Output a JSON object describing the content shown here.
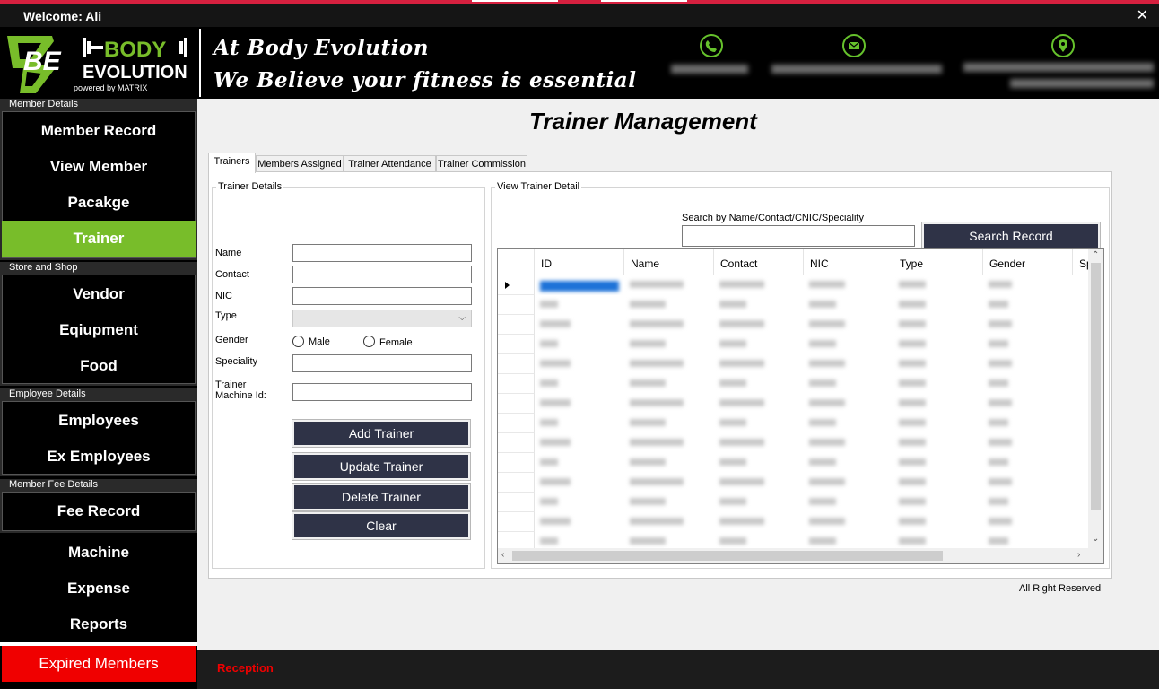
{
  "window": {
    "welcome": "Welcome: Ali",
    "close_glyph": "✕"
  },
  "brand": {
    "logo_letters": "BE",
    "name_line1": "BODY",
    "name_line2": "EVOLUTION",
    "powered": "powered by MATRIX",
    "slogan_line1": "At Body Evolution",
    "slogan_line2": "We Believe your fitness is essential",
    "accent": "#78bd2a",
    "icons": [
      "phone-icon",
      "mail-icon",
      "location-pin-icon"
    ]
  },
  "sidebar": {
    "groups": [
      {
        "label": "Member Details",
        "items": [
          "Member Record",
          "View Member",
          "Pacakge",
          "Trainer"
        ]
      },
      {
        "label": "Store and Shop",
        "items": [
          "Vendor",
          "Eqiupment",
          "Food"
        ]
      },
      {
        "label": "Employee Details",
        "items": [
          "Employees",
          "Ex Employees"
        ]
      },
      {
        "label": "Member Fee Details",
        "items": [
          "Fee Record"
        ]
      }
    ],
    "items": [
      "Machine",
      "Expense",
      "Reports"
    ],
    "expired": "Expired Members",
    "active_item": "Trainer"
  },
  "page": {
    "title": "Trainer Management"
  },
  "tabs": [
    "Trainers",
    "Members Assigned",
    "Trainer Attendance",
    "Trainer Commission"
  ],
  "form": {
    "legend": "Trainer Details",
    "name_label": "Name",
    "name_value": "",
    "contact_label": "Contact",
    "contact_value": "",
    "nic_label": "NIC",
    "nic_value": "",
    "type_label": "Type",
    "type_value": "",
    "gender_label": "Gender",
    "gender_male": "Male",
    "gender_female": "Female",
    "speciality_label": "Speciality",
    "speciality_value": "",
    "machine_label_1": "Trainer",
    "machine_label_2": "Machine Id:",
    "machine_value": "",
    "buttons": {
      "add": "Add Trainer",
      "update": "Update Trainer",
      "delete": "Delete Trainer",
      "clear": "Clear"
    }
  },
  "view": {
    "legend": "View Trainer Detail",
    "search_label": "Search by Name/Contact/CNIC/Speciality",
    "search_value": "",
    "search_button": "Search Record",
    "columns": [
      "ID",
      "Name",
      "Contact",
      "NIC",
      "Type",
      "Gender",
      "Sp"
    ],
    "row_count": 14
  },
  "footer": {
    "note": "All Right Reserved",
    "status": "Reception"
  }
}
